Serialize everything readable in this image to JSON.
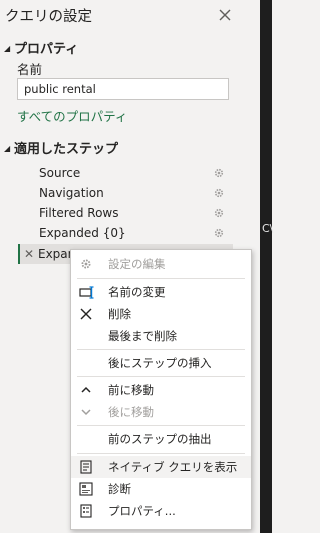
{
  "pane": {
    "title": "クエリの設定",
    "close_icon": "close-icon"
  },
  "properties": {
    "section_title": "プロパティ",
    "name_label": "名前",
    "name_value": "public rental",
    "all_properties_link": "すべてのプロパティ"
  },
  "applied_steps": {
    "section_title": "適用したステップ",
    "steps": [
      {
        "label": "Source",
        "icon": "gear-icon"
      },
      {
        "label": "Navigation",
        "icon": "gear-icon"
      },
      {
        "label": "Filtered Rows",
        "icon": "gear-icon"
      },
      {
        "label": "Expanded {0}",
        "icon": "gear-icon"
      },
      {
        "label": "Expan",
        "icon": "delete-x-icon"
      }
    ]
  },
  "right_strip": {
    "text": "C\\"
  },
  "context_menu": {
    "items": [
      {
        "label": "設定の編集",
        "icon": "gear-icon",
        "enabled": false
      },
      {
        "label": "名前の変更",
        "icon": "rename-icon",
        "enabled": true
      },
      {
        "label": "削除",
        "icon": "close-icon",
        "enabled": true
      },
      {
        "label": "最後まで削除",
        "icon": "",
        "enabled": true
      },
      {
        "label": "後にステップの挿入",
        "icon": "",
        "enabled": true
      },
      {
        "label": "前に移動",
        "icon": "chevron-up-icon",
        "enabled": true
      },
      {
        "label": "後に移動",
        "icon": "chevron-down-icon",
        "enabled": false
      },
      {
        "label": "前のステップの抽出",
        "icon": "",
        "enabled": true
      },
      {
        "label": "ネイティブ クエリを表示",
        "icon": "native-query-icon",
        "enabled": true
      },
      {
        "label": "診断",
        "icon": "diagnostics-icon",
        "enabled": true
      },
      {
        "label": "プロパティ...",
        "icon": "properties-icon",
        "enabled": true
      }
    ]
  },
  "colors": {
    "accent": "#217346",
    "pane_bg": "#f3f2f1",
    "selected_bg": "#e1dfdd",
    "disabled_text": "#a19f9d"
  }
}
